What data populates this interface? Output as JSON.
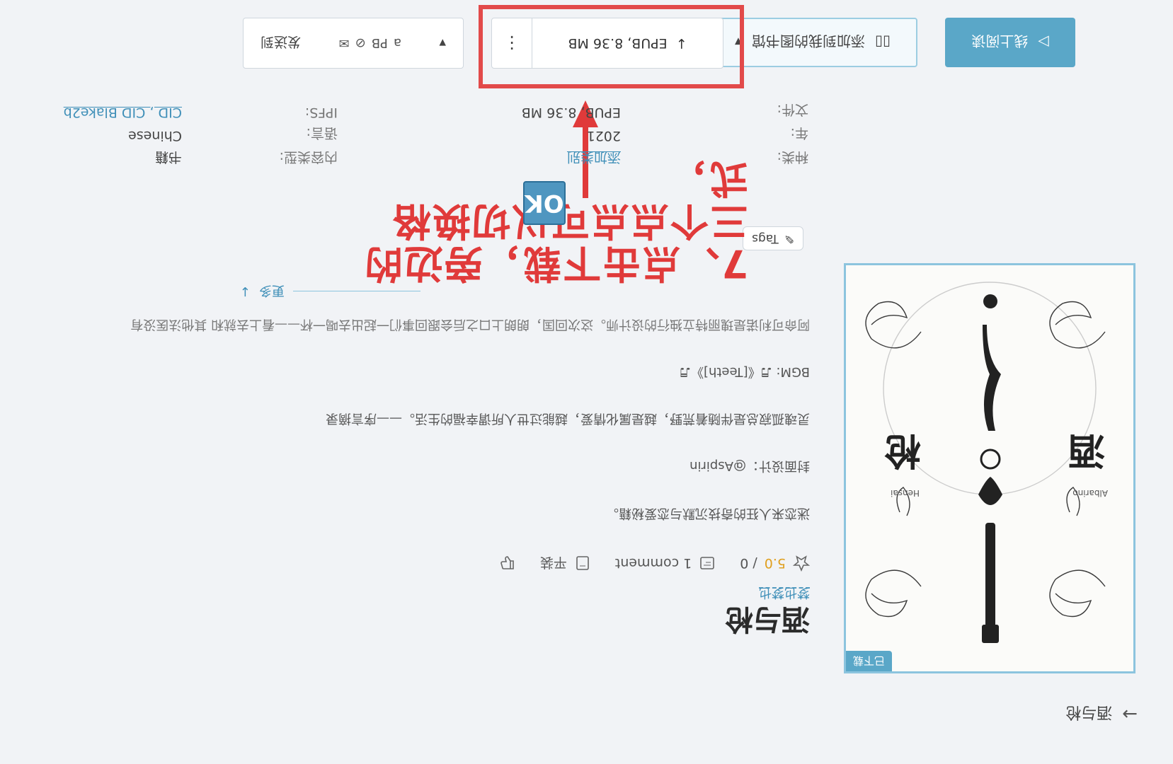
{
  "breadcrumb": {
    "label": "酒与枪"
  },
  "cover": {
    "badge": "已下载",
    "left_word": "酒",
    "right_word": "枪",
    "left_sub": "Albarino",
    "right_sub": "Hensai"
  },
  "book": {
    "title": "酒与枪",
    "author": "梦也梦也",
    "rating_value": "5.0",
    "rating_count": "/ 0",
    "comments": "1 comment",
    "quality": "平装"
  },
  "description": {
    "line1": "迷恋来人狂的奇技沉默与恋爱秘籍。",
    "line2": "封面设计：@Aspirin",
    "line3": "灵魂孤寂总是伴随着荒野，越是属化情爱，越能过世人所谓幸福的生活。——序言摘录",
    "line4": "BGM: ♬《[Teeth]》♬",
    "line5": "阿命可利诺是瑰丽特立独行的设计师。这次回国，朗朗上口之后会跟回事们一起出去喝一杯——看上去就和 其他法医没有"
  },
  "more": {
    "label": "更多"
  },
  "tags": {
    "label": "Tags"
  },
  "meta": {
    "category_label": "种类:",
    "category_value": "添加类别",
    "year_label": "年:",
    "year_value": "2021",
    "file_label": "文件:",
    "file_value": "EPUB, 8.36 MB",
    "content_type_label": "内容类型:",
    "content_type_value": "书籍",
    "language_label": "语言:",
    "language_value": "Chinese",
    "ipfs_label": "IPFS:",
    "ipfs_value": "CID , CID Blake2b"
  },
  "annotation": {
    "line1": "7、点击下载，旁边的",
    "line2": "三个点点可以切换格",
    "line3": "式，",
    "ok": "OK"
  },
  "actions": {
    "read_online": "线上阅读",
    "add_shelf": "添加到我的图书馆",
    "download": "EPUB, 8.36 MB",
    "download_more": "⋮",
    "send_to": "发送到",
    "send_targets": "PB",
    "send_extra": "a"
  },
  "colors": {
    "accent": "#5aa7c8",
    "annotation": "#e03a3a",
    "link": "#3f8fb8"
  }
}
